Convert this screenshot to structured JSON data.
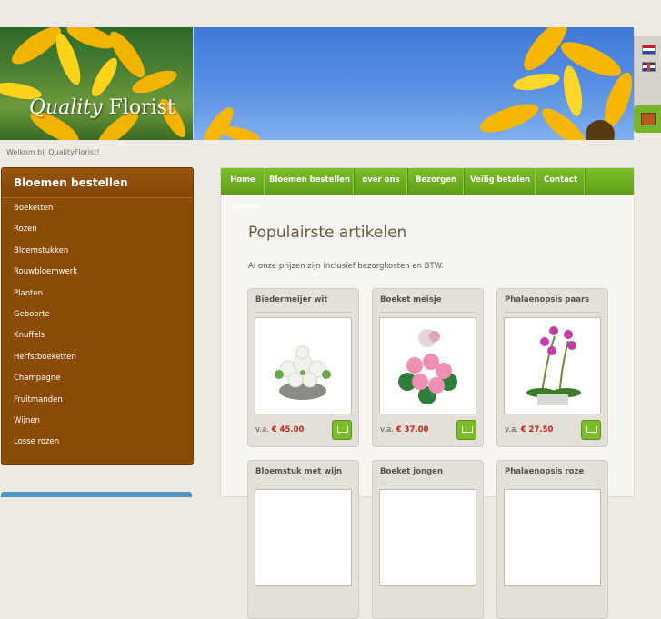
{
  "site": {
    "logo_prefix": "Quality",
    "logo_suffix": "Florist",
    "welcome": "Welkom bij QualityFlorist!"
  },
  "sidebar": {
    "title": "Bloemen bestellen",
    "items": [
      {
        "label": "Boeketten"
      },
      {
        "label": "Rozen"
      },
      {
        "label": "Bloemstukken"
      },
      {
        "label": "Rouwbloemwerk"
      },
      {
        "label": "Planten"
      },
      {
        "label": "Geboorte"
      },
      {
        "label": "Knuffels"
      },
      {
        "label": "Herfstboeketten"
      },
      {
        "label": "Champagne"
      },
      {
        "label": "Fruitmanden"
      },
      {
        "label": "Wijnen"
      },
      {
        "label": "Losse rozen"
      }
    ]
  },
  "nav": {
    "items": [
      {
        "label": "Home"
      },
      {
        "label": "Bloemen bestellen"
      },
      {
        "label": "over ons"
      },
      {
        "label": "Bezorgen"
      },
      {
        "label": "Veilig betalen"
      },
      {
        "label": "Contact"
      }
    ],
    "sub_label": "Zakelijk"
  },
  "main": {
    "title": "Populairste artikelen",
    "intro": "Al onze prijzen zijn inclusief bezorgkosten en BTW.",
    "price_prefix": "v.a.",
    "products": [
      {
        "name": "Biedermeijer wit",
        "price": "€ 45.00"
      },
      {
        "name": "Boeket meisje",
        "price": "€ 37.00"
      },
      {
        "name": "Phalaenopsis paars",
        "price": "€ 27.50"
      },
      {
        "name": "Bloemstuk met wijn",
        "price": ""
      },
      {
        "name": "Boeket jongen",
        "price": ""
      },
      {
        "name": "Phalaenopsis roze",
        "price": ""
      }
    ]
  },
  "colors": {
    "nav_green": "#6aac1e",
    "sidebar_brown": "#8a4b06",
    "price_red": "#c0251b",
    "background": "#edeae3"
  }
}
